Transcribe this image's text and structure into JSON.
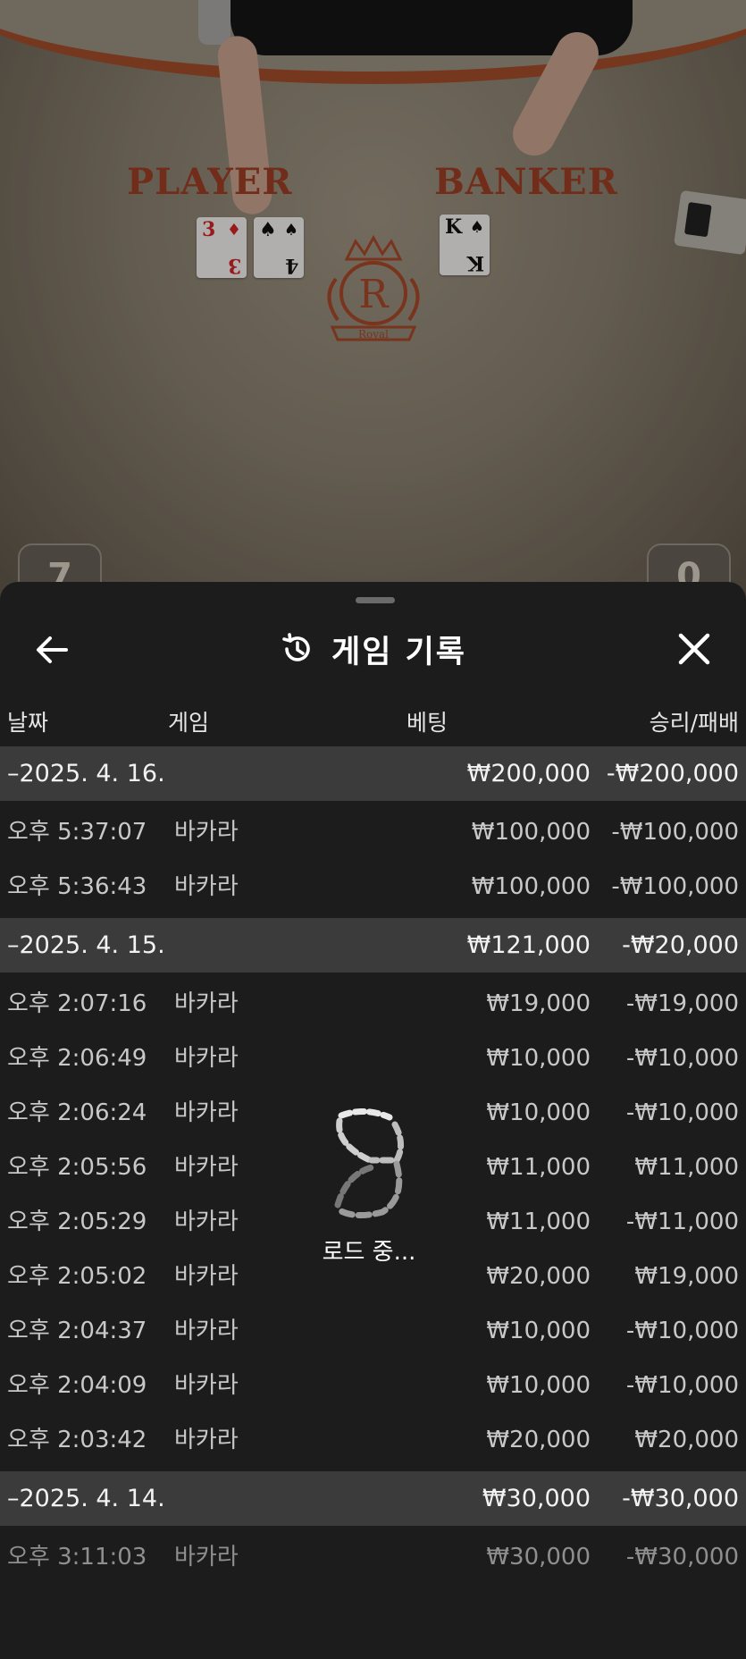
{
  "table": {
    "player_label": "PLAYER",
    "banker_label": "BANKER",
    "crest_letter": "R",
    "crest_word": "Royal",
    "player_cards": [
      {
        "rank": "3",
        "suit": "♦",
        "color": "red"
      },
      {
        "rank": "4",
        "suit": "♠",
        "color": "black"
      }
    ],
    "banker_cards": [
      {
        "rank": "K",
        "suit": "♠",
        "color": "black"
      }
    ],
    "player_score": "7",
    "banker_score": "0",
    "felt_color": "#8a8070",
    "trim_color": "#a44d2c"
  },
  "sheet": {
    "title": "게임 기록",
    "back_icon": "arrow-left-icon",
    "history_icon": "history-clock-icon",
    "close_icon": "close-icon",
    "columns": {
      "date": "날짜",
      "game": "게임",
      "bet": "베팅",
      "winloss": "승리/패배"
    },
    "groups": [
      {
        "date": "–2025. 4. 16.",
        "bet": "₩200,000",
        "winloss": "-₩200,000",
        "items": [
          {
            "time": "오후 5:37:07",
            "game": "바카라",
            "bet": "₩100,000",
            "winloss": "-₩100,000"
          },
          {
            "time": "오후 5:36:43",
            "game": "바카라",
            "bet": "₩100,000",
            "winloss": "-₩100,000"
          }
        ]
      },
      {
        "date": "–2025. 4. 15.",
        "bet": "₩121,000",
        "winloss": "-₩20,000",
        "items": [
          {
            "time": "오후 2:07:16",
            "game": "바카라",
            "bet": "₩19,000",
            "winloss": "-₩19,000"
          },
          {
            "time": "오후 2:06:49",
            "game": "바카라",
            "bet": "₩10,000",
            "winloss": "-₩10,000"
          },
          {
            "time": "오후 2:06:24",
            "game": "바카라",
            "bet": "₩10,000",
            "winloss": "-₩10,000"
          },
          {
            "time": "오후 2:05:56",
            "game": "바카라",
            "bet": "₩11,000",
            "winloss": "₩11,000"
          },
          {
            "time": "오후 2:05:29",
            "game": "바카라",
            "bet": "₩11,000",
            "winloss": "-₩11,000"
          },
          {
            "time": "오후 2:05:02",
            "game": "바카라",
            "bet": "₩20,000",
            "winloss": "₩19,000"
          },
          {
            "time": "오후 2:04:37",
            "game": "바카라",
            "bet": "₩10,000",
            "winloss": "-₩10,000"
          },
          {
            "time": "오후 2:04:09",
            "game": "바카라",
            "bet": "₩10,000",
            "winloss": "-₩10,000"
          },
          {
            "time": "오후 2:03:42",
            "game": "바카라",
            "bet": "₩20,000",
            "winloss": "₩20,000"
          }
        ]
      },
      {
        "date": "–2025. 4. 14.",
        "bet": "₩30,000",
        "winloss": "-₩30,000",
        "items": [
          {
            "time": "오후 3:11:03",
            "game": "바카라",
            "bet": "₩30,000",
            "winloss": "-₩30,000"
          }
        ]
      }
    ],
    "loading_text": "로드 중...",
    "loading_icon": "spinner-icon"
  }
}
